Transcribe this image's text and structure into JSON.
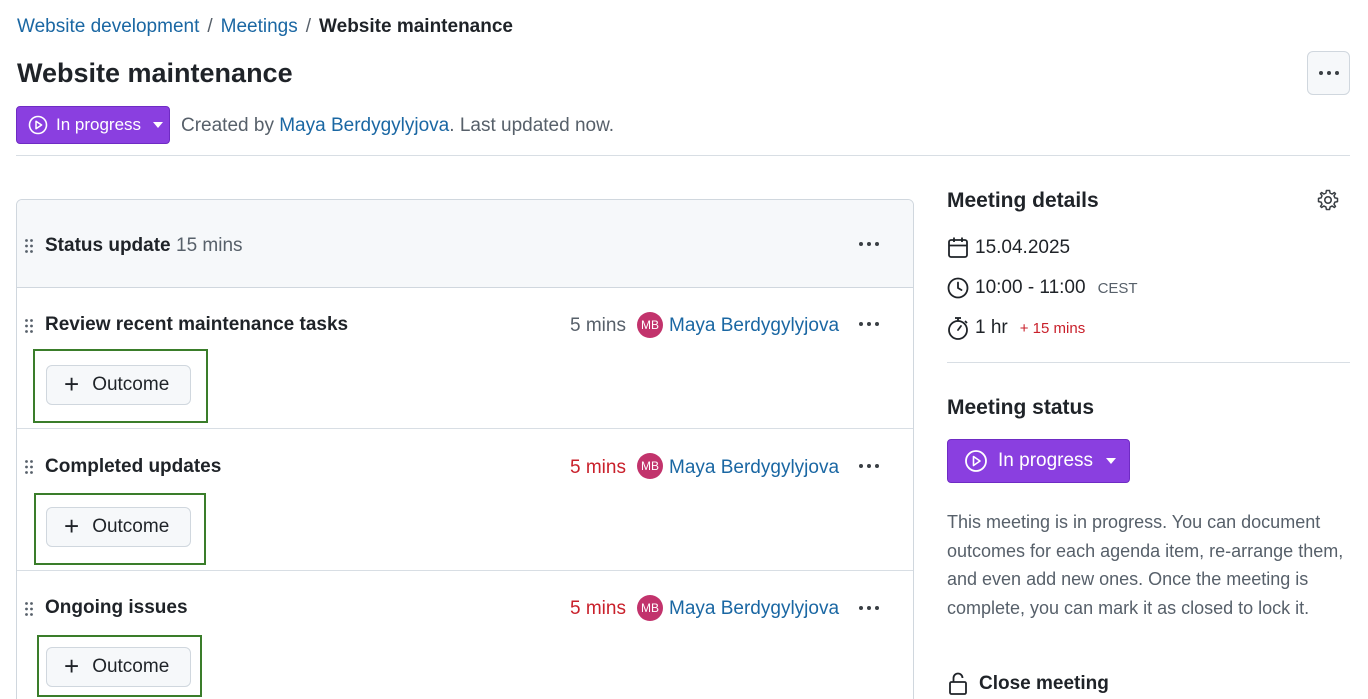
{
  "breadcrumb": {
    "items": [
      "Website development",
      "Meetings"
    ],
    "current": "Website maintenance",
    "separator": "/"
  },
  "page": {
    "title": "Website maintenance",
    "status_label": "In progress",
    "created_prefix": "Created by",
    "author": "Maya Berdygylyjova",
    "updated_text": ". Last updated now."
  },
  "agenda": {
    "section": {
      "title": "Status update",
      "duration": "15 mins"
    },
    "items": [
      {
        "title": "Review recent maintenance tasks",
        "duration": "5 mins",
        "duration_over": false,
        "initials": "MB",
        "responsible": "Maya Berdygylyjova",
        "outcome_label": "Outcome"
      },
      {
        "title": "Completed updates",
        "duration": "5 mins",
        "duration_over": true,
        "initials": "MB",
        "responsible": "Maya Berdygylyjova",
        "outcome_label": "Outcome"
      },
      {
        "title": "Ongoing issues",
        "duration": "5 mins",
        "duration_over": true,
        "initials": "MB",
        "responsible": "Maya Berdygylyjova",
        "outcome_label": "Outcome"
      }
    ]
  },
  "sidebar": {
    "details_title": "Meeting details",
    "date": "15.04.2025",
    "time": "10:00 - 11:00",
    "timezone": "CEST",
    "duration": "1 hr",
    "duration_extra": "+ 15 mins",
    "status_title": "Meeting status",
    "status_label": "In progress",
    "status_description": "This meeting is in progress. You can document outcomes for each agenda item, re-arrange them, and even add new ones. Once the meeting is complete, you can mark it as closed to lock it.",
    "close_label": "Close meeting"
  },
  "colors": {
    "accent_purple": "#8a3fe0",
    "link": "#1a67a3",
    "overtime_red": "#c9202b",
    "avatar": "#c2336c",
    "highlight_green": "#3a7d2a"
  }
}
